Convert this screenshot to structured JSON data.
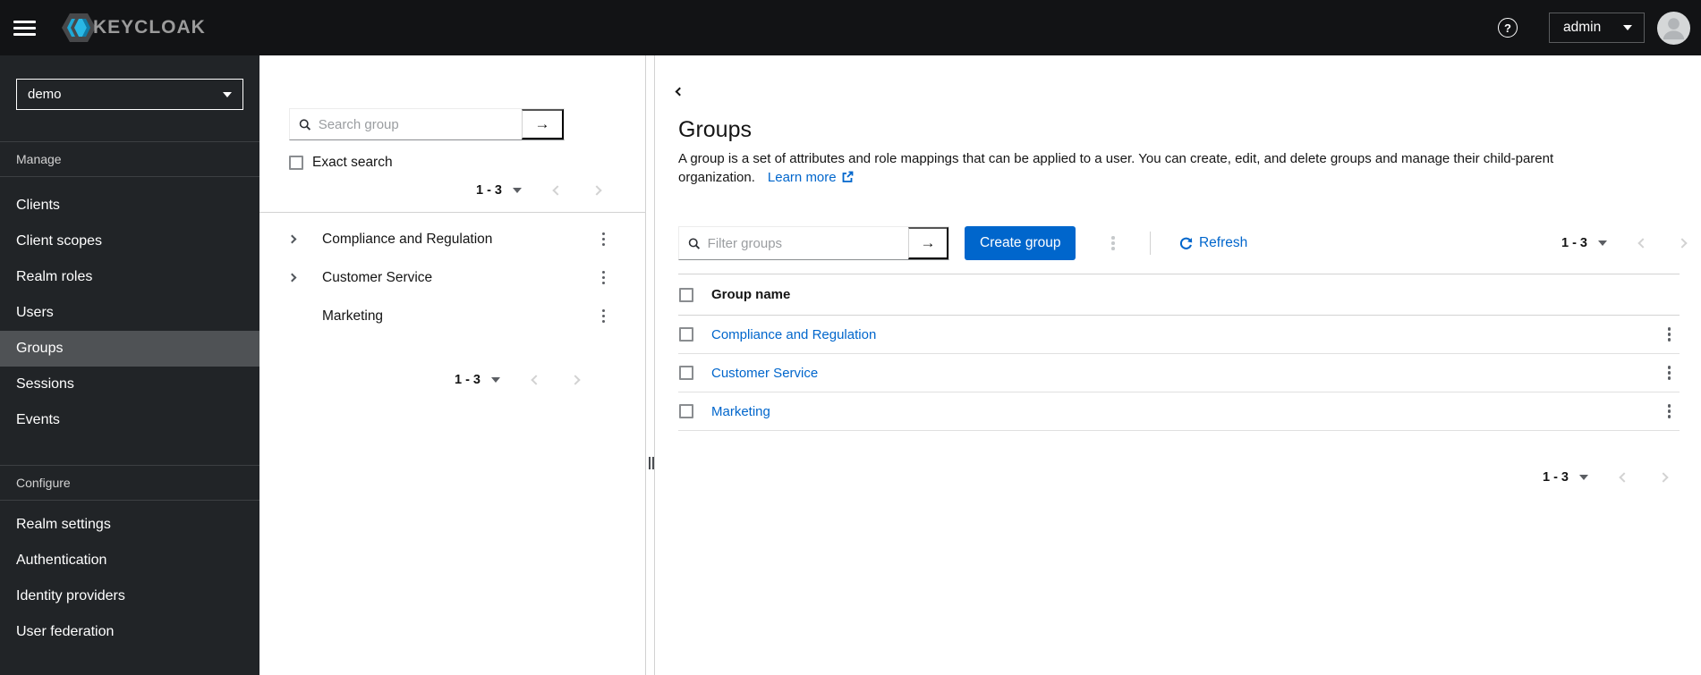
{
  "masthead": {
    "brand": "KEYCLOAK",
    "user": "admin"
  },
  "icons": {
    "help_glyph": "?",
    "arrow_right": "→"
  },
  "sidebar": {
    "realm": "demo",
    "manage": {
      "label": "Manage",
      "items": [
        "Clients",
        "Client scopes",
        "Realm roles",
        "Users",
        "Groups",
        "Sessions",
        "Events"
      ],
      "active_item": "Groups"
    },
    "configure": {
      "label": "Configure",
      "items": [
        "Realm settings",
        "Authentication",
        "Identity providers",
        "User federation"
      ]
    }
  },
  "tree": {
    "search_placeholder": "Search group",
    "exact_search_label": "Exact search",
    "pagination_top": "1 - 3",
    "pagination_bottom": "1 - 3",
    "items": [
      {
        "name": "Compliance and Regulation",
        "expandable": true
      },
      {
        "name": "Customer Service",
        "expandable": true
      },
      {
        "name": "Marketing",
        "expandable": false
      }
    ]
  },
  "main": {
    "title": "Groups",
    "description": "A group is a set of attributes and role mappings that can be applied to a user. You can create, edit, and delete groups and manage their child-parent organization.",
    "learn_more_label": "Learn more",
    "toolbar": {
      "filter_placeholder": "Filter groups",
      "create_label": "Create group",
      "refresh_label": "Refresh",
      "pagination": "1 - 3"
    },
    "table": {
      "header": "Group name",
      "rows": [
        {
          "name": "Compliance and Regulation"
        },
        {
          "name": "Customer Service"
        },
        {
          "name": "Marketing"
        }
      ]
    },
    "pagination_bottom": "1 - 3"
  },
  "colors": {
    "accent": "#0066cc",
    "masthead_bg": "#121315",
    "sidebar_bg": "#212427",
    "sidebar_active_bg": "#4f5255",
    "link": "#0066cc"
  }
}
